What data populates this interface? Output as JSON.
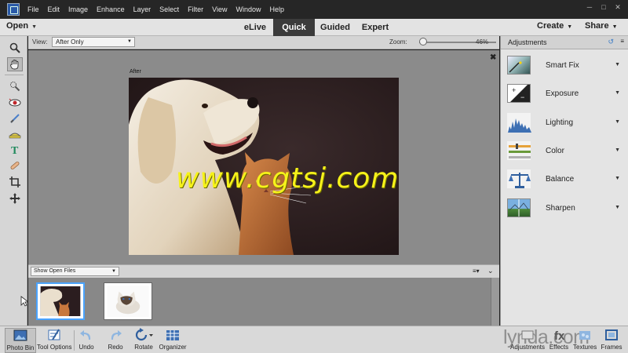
{
  "menubar": {
    "items": [
      "File",
      "Edit",
      "Image",
      "Enhance",
      "Layer",
      "Select",
      "Filter",
      "View",
      "Window",
      "Help"
    ]
  },
  "modebar": {
    "open_label": "Open",
    "tabs": [
      "eLive",
      "Quick",
      "Guided",
      "Expert"
    ],
    "active_tab": "Quick",
    "create_label": "Create",
    "share_label": "Share"
  },
  "options": {
    "view_label": "View:",
    "view_value": "After Only",
    "zoom_label": "Zoom:",
    "zoom_value": "46%",
    "zoom_level": 0.05
  },
  "canvas": {
    "view_caption": "After",
    "watermark": "www.cgtsj.com"
  },
  "photo_bin": {
    "filter_value": "Show Open Files"
  },
  "adjustments": {
    "title": "Adjustments",
    "items": [
      {
        "label": "Smart Fix",
        "icon": "smart-fix-icon"
      },
      {
        "label": "Exposure",
        "icon": "exposure-icon"
      },
      {
        "label": "Lighting",
        "icon": "lighting-icon"
      },
      {
        "label": "Color",
        "icon": "color-icon"
      },
      {
        "label": "Balance",
        "icon": "balance-icon"
      },
      {
        "label": "Sharpen",
        "icon": "sharpen-icon"
      }
    ]
  },
  "taskbar": {
    "left": [
      "Photo Bin",
      "Tool Options",
      "Undo",
      "Redo",
      "Rotate",
      "Organizer"
    ],
    "right": [
      "Adjustments",
      "Effects",
      "Textures",
      "Frames"
    ],
    "brand": "lynda.com"
  },
  "colors": {
    "active_tab_bg": "#3b3b3b",
    "selection_border": "#4aa3ff",
    "watermark": "#f6f21a"
  }
}
